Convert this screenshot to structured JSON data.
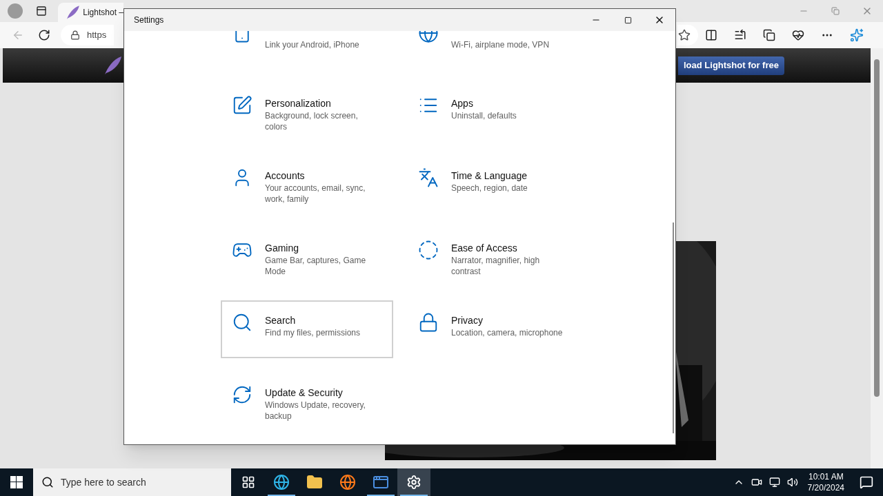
{
  "browser": {
    "tabs": [
      {
        "title": "Lightshot –",
        "selected": true
      }
    ],
    "address": {
      "value": "https"
    },
    "back_disabled": true,
    "page": {
      "download_button": "load Lightshot for free"
    }
  },
  "settings": {
    "title": "Settings",
    "items": [
      {
        "description": "Link your Android, iPhone",
        "selected": false
      },
      {
        "description": "Wi-Fi, airplane mode, VPN",
        "selected": false
      },
      {
        "title": "Personalization",
        "description": "Background, lock screen, colors",
        "selected": false
      },
      {
        "title": "Apps",
        "description": "Uninstall, defaults",
        "selected": false
      },
      {
        "title": "Accounts",
        "description": "Your accounts, email, sync, work, family",
        "selected": false
      },
      {
        "title": "Time & Language",
        "description": "Speech, region, date",
        "selected": false
      },
      {
        "title": "Gaming",
        "description": "Game Bar, captures, Game Mode",
        "selected": false
      },
      {
        "title": "Ease of Access",
        "description": "Narrator, magnifier, high contrast",
        "selected": false
      },
      {
        "title": "Search",
        "description": "Find my files, permissions",
        "selected": true
      },
      {
        "title": "Privacy",
        "description": "Location, camera, microphone",
        "selected": false
      },
      {
        "title": "Update & Security",
        "description": "Windows Update, recovery, backup",
        "selected": false
      }
    ]
  },
  "taskbar": {
    "search_placeholder": "Type here to search",
    "apps": [
      {
        "selected": false,
        "running": false
      },
      {
        "selected": false,
        "running": true
      },
      {
        "selected": false,
        "running": false
      },
      {
        "selected": false,
        "running": false
      },
      {
        "selected": false,
        "running": true
      },
      {
        "selected": true,
        "running": true
      }
    ],
    "time": "10:01 AM",
    "date": "7/20/2024"
  }
}
